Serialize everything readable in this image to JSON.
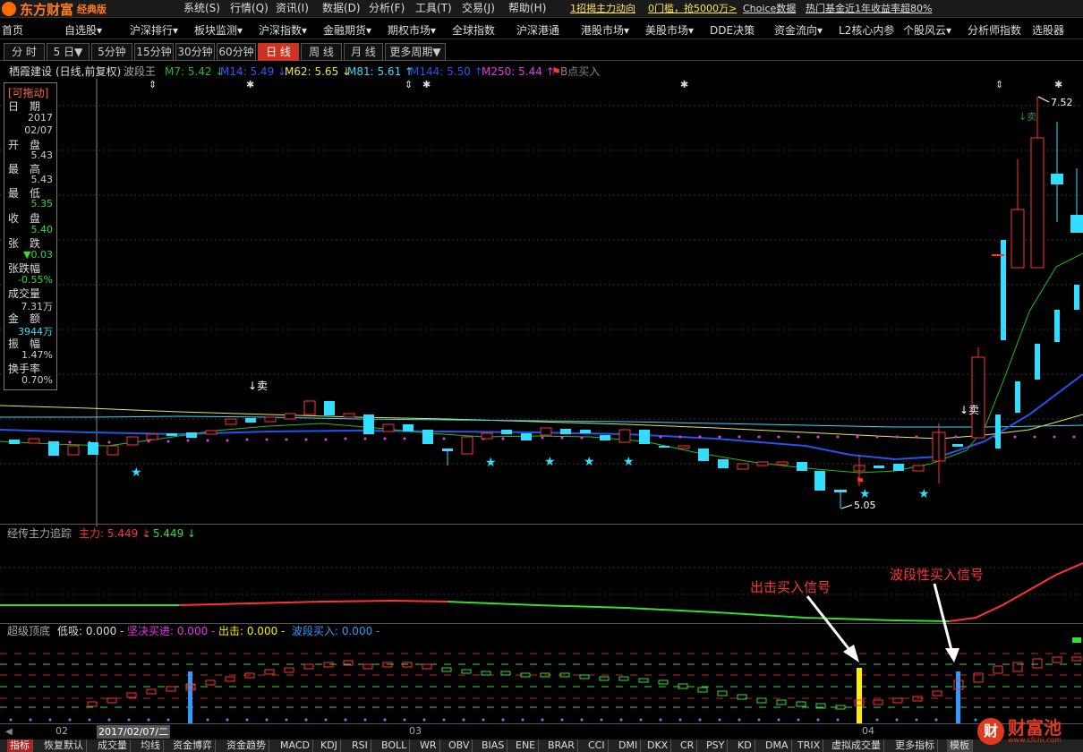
{
  "app": {
    "logo": "东方财富",
    "edition": "经典版"
  },
  "menubar": [
    "系统(S)",
    "行情(Q)",
    "资讯(I)",
    "数据(D)",
    "分析(F)",
    "工具(T)",
    "交易(J)",
    "帮助(H)"
  ],
  "ads": [
    "1招揭主力动向",
    "0门槛，抢5000万>",
    "Choice数据",
    "热门基金近1年收益率超80%"
  ],
  "nav": [
    "首页",
    "自选股▾",
    "沪深排行▾",
    "板块监测▾",
    "沪深指数▾",
    "金融期货▾",
    "期权市场▾",
    "全球指数",
    "沪深港通",
    "港股市场▾",
    "美股市场▾",
    "DDE决策",
    "资金流向▾",
    "L2核心内参",
    "个股风云▾",
    "分析师指数",
    "选股器"
  ],
  "periods": [
    "分 时",
    "5 日▼",
    "5分钟",
    "15分钟",
    "30分钟",
    "60分钟",
    "日 线",
    "周 线",
    "月 线",
    "更多周期▼"
  ],
  "active_period": "日 线",
  "legend": {
    "stock": "栖霞建设",
    "mode": "(日线,前复权)",
    "indicator": "波段王",
    "items": [
      {
        "text": "M7: 5.42 ↓",
        "color": "#1fbf1f"
      },
      {
        "text": "M14: 5.49 ↓",
        "color": "#3355ff"
      },
      {
        "text": "M62: 5.65 ↓",
        "color": "#e8e84a"
      },
      {
        "text": "M81: 5.61 ↑",
        "color": "#33ddff"
      },
      {
        "text": "M144: 5.50 ↑",
        "color": "#2255ee"
      },
      {
        "text": "M250: 5.44 ↑",
        "color": "#ee33ee"
      },
      {
        "text": "B点买入",
        "color": "#888888"
      }
    ]
  },
  "info": {
    "title": "[可拖动]",
    "rows": [
      {
        "label": "日　期",
        "value": "2017",
        "color": "#cccccc"
      },
      {
        "label": "",
        "value": "02/07",
        "color": "#cccccc"
      },
      {
        "label": "开　盘",
        "value": "5.43",
        "color": "#cccccc"
      },
      {
        "label": "最　高",
        "value": "5.43",
        "color": "#cccccc"
      },
      {
        "label": "最　低",
        "value": "5.35",
        "color": "#33dd33"
      },
      {
        "label": "收　盘",
        "value": "5.40",
        "color": "#33dd33"
      },
      {
        "label": "张　跌",
        "value": "▼0.03",
        "color": "#33dd33"
      },
      {
        "label": "张跌幅",
        "value": "-0.55%",
        "color": "#33dd33"
      },
      {
        "label": "成交量",
        "value": "7.31万",
        "color": "#cccccc"
      },
      {
        "label": "金　额",
        "value": "3944万",
        "color": "#33ddff"
      },
      {
        "label": "振　幅",
        "value": "1.47%",
        "color": "#cccccc"
      },
      {
        "label": "换手率",
        "value": "0.70%",
        "color": "#cccccc"
      }
    ]
  },
  "chart_labels": {
    "high": "7.52",
    "low": "5.05",
    "sell1": "↓卖",
    "sell2": "↓卖",
    "sell3": "↓卖"
  },
  "panel2": {
    "title": "经传主力追踪",
    "items": [
      {
        "text": "主力: 5.449 ↓",
        "color": "#ff3333"
      },
      {
        "text": ": 5.449 ↓",
        "color": "#33dd33"
      }
    ]
  },
  "panel3": {
    "title": "超级顶底",
    "items": [
      {
        "text": "低吸: 0.000 -",
        "color": "#dddddd"
      },
      {
        "text": "坚决买进: 0.000 -",
        "color": "#ee33ee"
      },
      {
        "text": "出击: 0.000 -",
        "color": "#ffee00"
      },
      {
        "text": "波段买入: 0.000 -",
        "color": "#3399ff"
      }
    ]
  },
  "annotations": {
    "attack": "出击买入信号",
    "band": "波段性买入信号"
  },
  "xaxis": {
    "labels": [
      "02",
      "03",
      "04"
    ],
    "cursor_date": "2017/02/07/二"
  },
  "tabs": [
    "指标",
    "恢复默认",
    "成交量",
    "均线",
    "资金博弈",
    "资金趋势",
    "MACD",
    "KDJ",
    "RSI",
    "BOLL",
    "WR",
    "OBV",
    "BIAS",
    "ENE",
    "BRAR",
    "CCI",
    "DMI",
    "DKX",
    "CR",
    "PSY",
    "KD",
    "DMA",
    "TRIX",
    "虚拟成交量",
    "更多指标",
    "模板"
  ],
  "watermark": {
    "brand": "财富池",
    "url": "www.cfchi.com"
  }
}
